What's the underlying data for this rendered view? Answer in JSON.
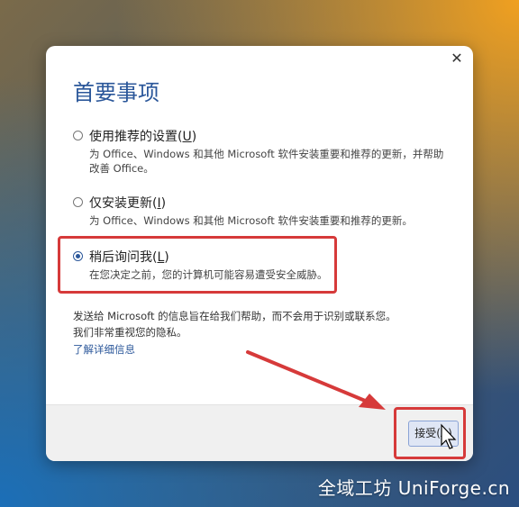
{
  "dialog": {
    "title": "首要事项",
    "close_symbol": "✕",
    "options": [
      {
        "label_pre": "使用推荐的设置(",
        "accel": "U",
        "label_post": ")",
        "desc": "为 Office、Windows 和其他 Microsoft 软件安装重要和推荐的更新，并帮助改善 Office。",
        "checked": false
      },
      {
        "label_pre": "仅安装更新(",
        "accel": "I",
        "label_post": ")",
        "desc": "为 Office、Windows 和其他 Microsoft 软件安装重要和推荐的更新。",
        "checked": false
      },
      {
        "label_pre": "稍后询问我(",
        "accel": "L",
        "label_post": ")",
        "desc": "在您决定之前，您的计算机可能容易遭受安全威胁。",
        "checked": true
      }
    ],
    "info_line1": "发送给 Microsoft 的信息旨在给我们帮助，而不会用于识别或联系您。",
    "info_line2": "我们非常重视您的隐私。",
    "learn_more": "了解详细信息",
    "accept_button": "接受(A)"
  },
  "annotation_color": "#d63a3a",
  "watermark": "全域工坊 UniForge.cn"
}
